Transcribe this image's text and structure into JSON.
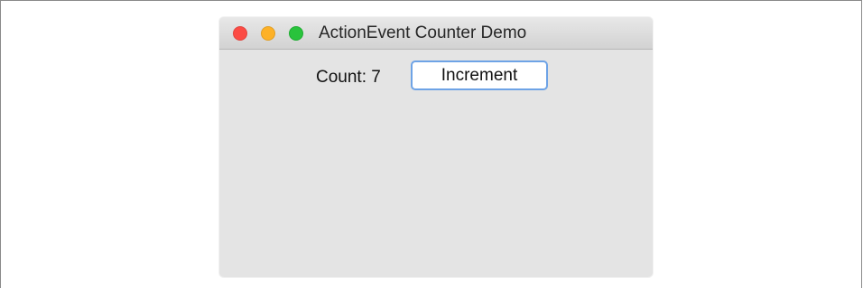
{
  "window": {
    "title": "ActionEvent Counter Demo"
  },
  "counter": {
    "label": "Count: 7",
    "button_label": "Increment"
  },
  "colors": {
    "close": "#fc4b44",
    "minimize": "#fdb127",
    "zoom": "#29c33c",
    "focus_ring": "#6ea3e6"
  },
  "icons": [
    "close-icon",
    "minimize-icon",
    "zoom-icon"
  ]
}
